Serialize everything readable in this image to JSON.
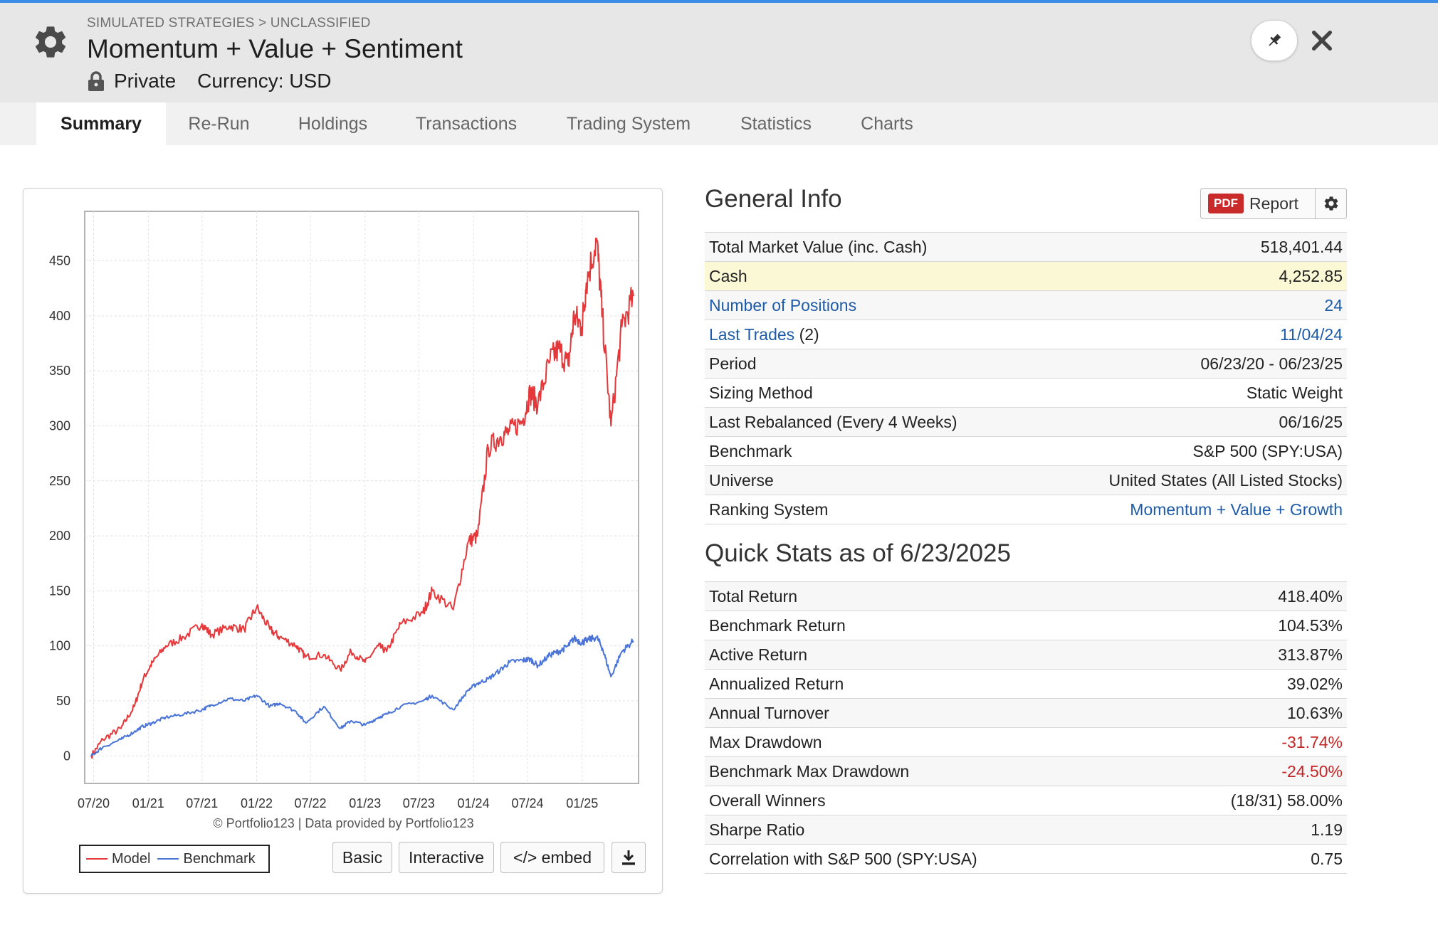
{
  "header": {
    "breadcrumb": "SIMULATED STRATEGIES > UNCLASSIFIED",
    "title": "Momentum + Value + Sentiment",
    "privacy": "Private",
    "currency": "Currency: USD",
    "icons": [
      "gear-icon",
      "lock-icon",
      "pin-icon",
      "close-icon"
    ]
  },
  "tabs": [
    {
      "label": "Summary",
      "active": true
    },
    {
      "label": "Re-Run"
    },
    {
      "label": "Holdings"
    },
    {
      "label": "Transactions"
    },
    {
      "label": "Trading System"
    },
    {
      "label": "Statistics"
    },
    {
      "label": "Charts"
    }
  ],
  "chart_panel": {
    "copyright": "© Portfolio123 | Data provided by Portfolio123",
    "buttons": {
      "basic": "Basic",
      "interactive": "Interactive",
      "embed": "</> embed"
    },
    "legend": {
      "model": "Model",
      "benchmark": "Benchmark"
    }
  },
  "chart_data": {
    "type": "line",
    "title": "",
    "xlabel": "",
    "ylabel": "",
    "ylim": [
      -25,
      495
    ],
    "y_ticks": [
      0,
      50,
      100,
      150,
      200,
      250,
      300,
      350,
      400,
      450
    ],
    "x_ticks": [
      "07/20",
      "01/21",
      "07/21",
      "01/22",
      "07/22",
      "01/23",
      "07/23",
      "01/24",
      "07/24",
      "01/25"
    ],
    "grid": true,
    "legend_position": "bottom-left",
    "x": [
      "2020-06-23",
      "2020-08-01",
      "2020-10-01",
      "2020-11-15",
      "2020-12-15",
      "2021-01-15",
      "2021-03-01",
      "2021-05-01",
      "2021-07-01",
      "2021-08-01",
      "2021-10-01",
      "2021-11-20",
      "2022-01-01",
      "2022-02-15",
      "2022-03-20",
      "2022-05-15",
      "2022-06-15",
      "2022-08-15",
      "2022-10-10",
      "2022-11-15",
      "2023-01-01",
      "2023-02-15",
      "2023-03-15",
      "2023-05-01",
      "2023-07-15",
      "2023-08-15",
      "2023-10-25",
      "2023-12-15",
      "2024-01-15",
      "2024-02-20",
      "2024-03-31",
      "2024-05-01",
      "2024-06-15",
      "2024-07-10",
      "2024-08-05",
      "2024-09-15",
      "2024-10-15",
      "2024-11-15",
      "2024-12-05",
      "2024-12-31",
      "2025-01-15",
      "2025-02-19",
      "2025-03-10",
      "2025-04-08",
      "2025-05-15",
      "2025-06-23"
    ],
    "series": [
      {
        "name": "Model",
        "color": "#e5383b",
        "values": [
          0,
          15,
          25,
          45,
          70,
          85,
          100,
          108,
          120,
          110,
          118,
          115,
          135,
          115,
          108,
          100,
          90,
          92,
          78,
          95,
          85,
          100,
          95,
          120,
          130,
          150,
          133,
          195,
          200,
          280,
          290,
          295,
          305,
          330,
          320,
          360,
          370,
          355,
          400,
          390,
          430,
          470,
          400,
          300,
          390,
          418
        ]
      },
      {
        "name": "Benchmark",
        "color": "#4a74d8",
        "values": [
          0,
          8,
          15,
          22,
          27,
          30,
          35,
          38,
          42,
          46,
          52,
          50,
          55,
          45,
          48,
          40,
          30,
          45,
          25,
          32,
          28,
          35,
          38,
          45,
          50,
          55,
          42,
          60,
          66,
          70,
          78,
          85,
          87,
          88,
          82,
          92,
          95,
          100,
          107,
          103,
          105,
          108,
          98,
          72,
          95,
          104.53
        ]
      }
    ]
  },
  "general_info": {
    "heading": "General Info",
    "pdf_badge": "PDF",
    "pdf_label": "Report",
    "rows": [
      {
        "label": "Total Market Value (inc. Cash)",
        "value": "518,401.44"
      },
      {
        "label": "Cash",
        "value": "4,252.85"
      },
      {
        "label": "Number of Positions",
        "value": "24"
      },
      {
        "label": "Last Trades",
        "label_suffix": "(2)",
        "value": "11/04/24"
      },
      {
        "label": "Period",
        "value": "06/23/20 - 06/23/25"
      },
      {
        "label": "Sizing Method",
        "value": "Static Weight"
      },
      {
        "label": "Last Rebalanced (Every 4 Weeks)",
        "value": "06/16/25"
      },
      {
        "label": "Benchmark",
        "value": "S&P 500 (SPY:USA)"
      },
      {
        "label": "Universe",
        "value": "United States (All Listed Stocks)"
      },
      {
        "label": "Ranking System",
        "value": "Momentum + Value + Growth"
      }
    ]
  },
  "quick_stats": {
    "heading": "Quick Stats as of 6/23/2025",
    "rows": [
      {
        "label": "Total Return",
        "value": "418.40%"
      },
      {
        "label": "Benchmark Return",
        "value": "104.53%"
      },
      {
        "label": "Active Return",
        "value": "313.87%"
      },
      {
        "label": "Annualized Return",
        "value": "39.02%"
      },
      {
        "label": "Annual Turnover",
        "value": "10.63%"
      },
      {
        "label": "Max Drawdown",
        "value": "-31.74%"
      },
      {
        "label": "Benchmark Max Drawdown",
        "value": "-24.50%"
      },
      {
        "label": "Overall Winners",
        "value": "(18/31) 58.00%"
      },
      {
        "label": "Sharpe Ratio",
        "value": "1.19"
      },
      {
        "label": "Correlation with S&P 500 (SPY:USA)",
        "value": "0.75"
      }
    ]
  },
  "colors": {
    "link": "#1e5ba8",
    "negative": "#c22525",
    "highlight": "#fbf8d6",
    "accent": "#3b8ee8"
  }
}
